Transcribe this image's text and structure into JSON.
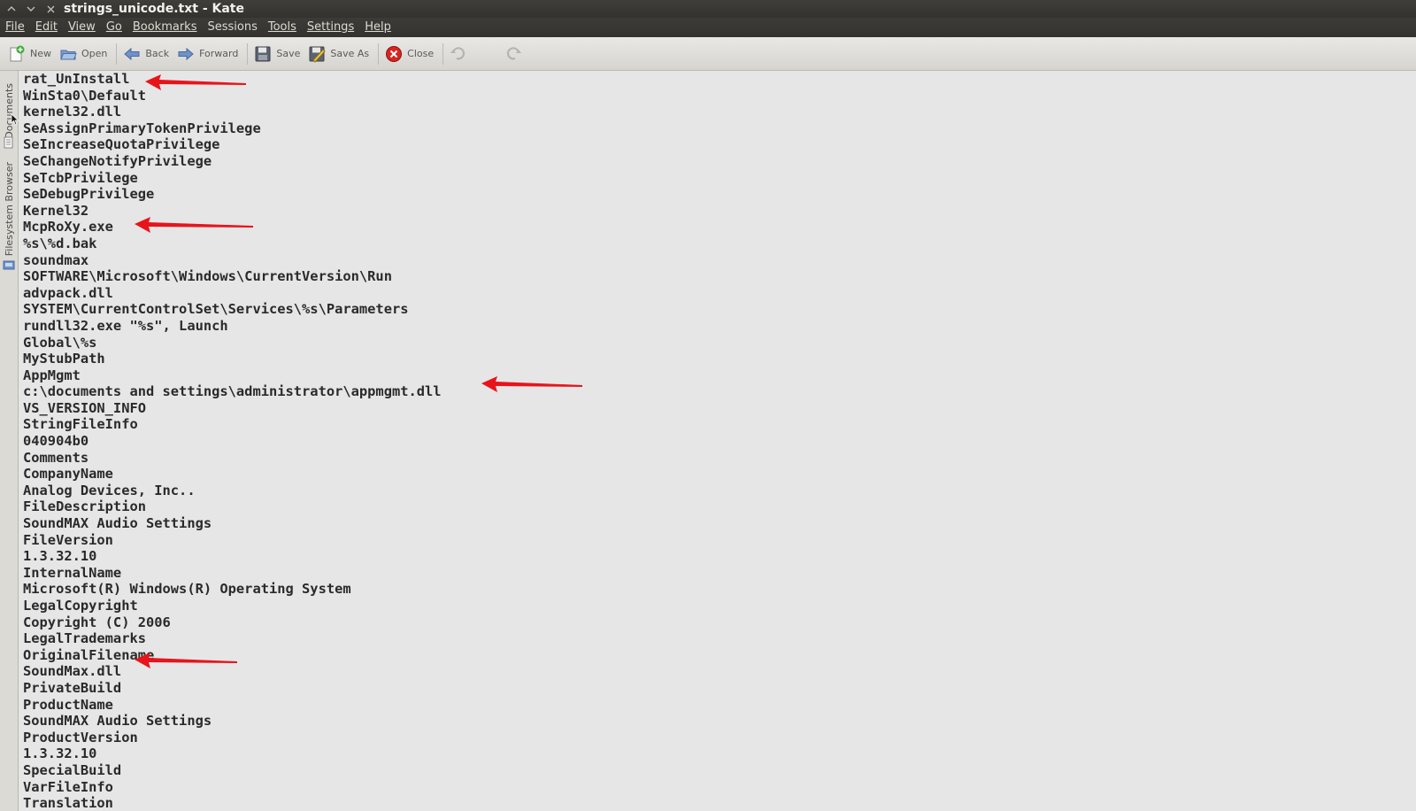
{
  "window": {
    "title": "strings_unicode.txt - Kate"
  },
  "menu": [
    {
      "label": "File"
    },
    {
      "label": "Edit"
    },
    {
      "label": "View"
    },
    {
      "label": "Go"
    },
    {
      "label": "Bookmarks"
    },
    {
      "label": "Sessions"
    },
    {
      "label": "Tools"
    },
    {
      "label": "Settings"
    },
    {
      "label": "Help"
    }
  ],
  "toolbar": {
    "new_label": "New",
    "open_label": "Open",
    "back_label": "Back",
    "forward_label": "Forward",
    "save_label": "Save",
    "save_as_label": "Save As",
    "close_label": "Close"
  },
  "sidebar": {
    "documents_label": "Documents",
    "filesystem_label": "Filesystem Browser"
  },
  "editor": {
    "lines": [
      "rat_UnInstall",
      "WinSta0\\Default",
      "kernel32.dll",
      "SeAssignPrimaryTokenPrivilege",
      "SeIncreaseQuotaPrivilege",
      "SeChangeNotifyPrivilege",
      "SeTcbPrivilege",
      "SeDebugPrivilege",
      "Kernel32",
      "McpRoXy.exe",
      "%s\\%d.bak",
      "soundmax",
      "SOFTWARE\\Microsoft\\Windows\\CurrentVersion\\Run",
      "advpack.dll",
      "SYSTEM\\CurrentControlSet\\Services\\%s\\Parameters",
      "rundll32.exe \"%s\", Launch",
      "Global\\%s",
      "MyStubPath",
      "AppMgmt",
      "c:\\documents and settings\\administrator\\appmgmt.dll",
      "VS_VERSION_INFO",
      "StringFileInfo",
      "040904b0",
      "Comments",
      "CompanyName",
      "Analog Devices, Inc..",
      "FileDescription",
      "SoundMAX Audio Settings",
      "FileVersion",
      "1.3.32.10",
      "InternalName",
      "Microsoft(R) Windows(R) Operating System",
      "LegalCopyright",
      "Copyright (C) 2006",
      "LegalTrademarks",
      "OriginalFilename",
      "SoundMax.dll",
      "PrivateBuild",
      "ProductName",
      "SoundMAX Audio Settings",
      "ProductVersion",
      "1.3.32.10",
      "SpecialBuild",
      "VarFileInfo",
      "Translation"
    ]
  },
  "annotations": {
    "arrow_color": "#e8141b"
  }
}
